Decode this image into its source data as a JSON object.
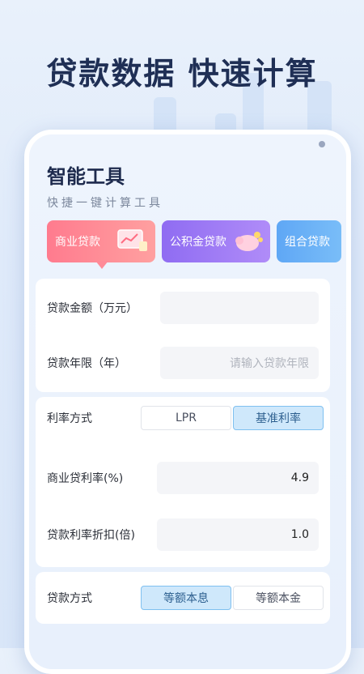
{
  "headline": "贷款数据 快速计算",
  "tools": {
    "title": "智能工具",
    "subtitle": "快捷一键计算工具",
    "tabs": [
      {
        "label": "商业贷款"
      },
      {
        "label": "公积金贷款"
      },
      {
        "label": "组合贷款"
      }
    ]
  },
  "form": {
    "amount_label": "贷款金额（万元）",
    "amount_value": "",
    "years_label": "贷款年限（年）",
    "years_placeholder": "请输入贷款年限",
    "rate_type_label": "利率方式",
    "rate_type_options": [
      "LPR",
      "基准利率"
    ],
    "rate_type_selected": "基准利率",
    "commercial_rate_label": "商业贷利率(%)",
    "commercial_rate_value": "4.9",
    "discount_label": "贷款利率折扣(倍)",
    "discount_value": "1.0",
    "method_label": "贷款方式",
    "method_options": [
      "等额本息",
      "等额本金"
    ],
    "method_selected": "等额本息"
  },
  "colors": {
    "headline": "#1f2f55",
    "tab_commercial": "#ff7b8e",
    "tab_fund": "#8f6cf2",
    "tab_combo": "#5fa7f5",
    "selected_segment": "#cfe8fb"
  }
}
